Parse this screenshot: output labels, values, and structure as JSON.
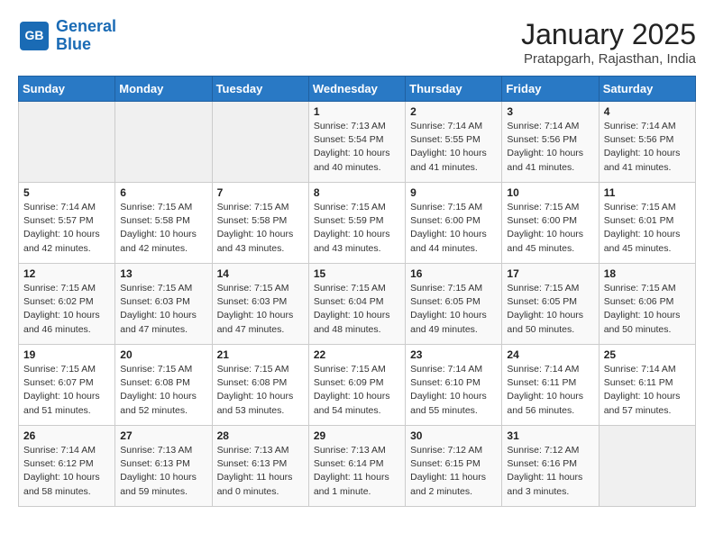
{
  "logo": {
    "line1": "General",
    "line2": "Blue"
  },
  "title": "January 2025",
  "subtitle": "Pratapgarh, Rajasthan, India",
  "weekdays": [
    "Sunday",
    "Monday",
    "Tuesday",
    "Wednesday",
    "Thursday",
    "Friday",
    "Saturday"
  ],
  "weeks": [
    [
      {
        "day": "",
        "info": ""
      },
      {
        "day": "",
        "info": ""
      },
      {
        "day": "",
        "info": ""
      },
      {
        "day": "1",
        "info": "Sunrise: 7:13 AM\nSunset: 5:54 PM\nDaylight: 10 hours\nand 40 minutes."
      },
      {
        "day": "2",
        "info": "Sunrise: 7:14 AM\nSunset: 5:55 PM\nDaylight: 10 hours\nand 41 minutes."
      },
      {
        "day": "3",
        "info": "Sunrise: 7:14 AM\nSunset: 5:56 PM\nDaylight: 10 hours\nand 41 minutes."
      },
      {
        "day": "4",
        "info": "Sunrise: 7:14 AM\nSunset: 5:56 PM\nDaylight: 10 hours\nand 41 minutes."
      }
    ],
    [
      {
        "day": "5",
        "info": "Sunrise: 7:14 AM\nSunset: 5:57 PM\nDaylight: 10 hours\nand 42 minutes."
      },
      {
        "day": "6",
        "info": "Sunrise: 7:15 AM\nSunset: 5:58 PM\nDaylight: 10 hours\nand 42 minutes."
      },
      {
        "day": "7",
        "info": "Sunrise: 7:15 AM\nSunset: 5:58 PM\nDaylight: 10 hours\nand 43 minutes."
      },
      {
        "day": "8",
        "info": "Sunrise: 7:15 AM\nSunset: 5:59 PM\nDaylight: 10 hours\nand 43 minutes."
      },
      {
        "day": "9",
        "info": "Sunrise: 7:15 AM\nSunset: 6:00 PM\nDaylight: 10 hours\nand 44 minutes."
      },
      {
        "day": "10",
        "info": "Sunrise: 7:15 AM\nSunset: 6:00 PM\nDaylight: 10 hours\nand 45 minutes."
      },
      {
        "day": "11",
        "info": "Sunrise: 7:15 AM\nSunset: 6:01 PM\nDaylight: 10 hours\nand 45 minutes."
      }
    ],
    [
      {
        "day": "12",
        "info": "Sunrise: 7:15 AM\nSunset: 6:02 PM\nDaylight: 10 hours\nand 46 minutes."
      },
      {
        "day": "13",
        "info": "Sunrise: 7:15 AM\nSunset: 6:03 PM\nDaylight: 10 hours\nand 47 minutes."
      },
      {
        "day": "14",
        "info": "Sunrise: 7:15 AM\nSunset: 6:03 PM\nDaylight: 10 hours\nand 47 minutes."
      },
      {
        "day": "15",
        "info": "Sunrise: 7:15 AM\nSunset: 6:04 PM\nDaylight: 10 hours\nand 48 minutes."
      },
      {
        "day": "16",
        "info": "Sunrise: 7:15 AM\nSunset: 6:05 PM\nDaylight: 10 hours\nand 49 minutes."
      },
      {
        "day": "17",
        "info": "Sunrise: 7:15 AM\nSunset: 6:05 PM\nDaylight: 10 hours\nand 50 minutes."
      },
      {
        "day": "18",
        "info": "Sunrise: 7:15 AM\nSunset: 6:06 PM\nDaylight: 10 hours\nand 50 minutes."
      }
    ],
    [
      {
        "day": "19",
        "info": "Sunrise: 7:15 AM\nSunset: 6:07 PM\nDaylight: 10 hours\nand 51 minutes."
      },
      {
        "day": "20",
        "info": "Sunrise: 7:15 AM\nSunset: 6:08 PM\nDaylight: 10 hours\nand 52 minutes."
      },
      {
        "day": "21",
        "info": "Sunrise: 7:15 AM\nSunset: 6:08 PM\nDaylight: 10 hours\nand 53 minutes."
      },
      {
        "day": "22",
        "info": "Sunrise: 7:15 AM\nSunset: 6:09 PM\nDaylight: 10 hours\nand 54 minutes."
      },
      {
        "day": "23",
        "info": "Sunrise: 7:14 AM\nSunset: 6:10 PM\nDaylight: 10 hours\nand 55 minutes."
      },
      {
        "day": "24",
        "info": "Sunrise: 7:14 AM\nSunset: 6:11 PM\nDaylight: 10 hours\nand 56 minutes."
      },
      {
        "day": "25",
        "info": "Sunrise: 7:14 AM\nSunset: 6:11 PM\nDaylight: 10 hours\nand 57 minutes."
      }
    ],
    [
      {
        "day": "26",
        "info": "Sunrise: 7:14 AM\nSunset: 6:12 PM\nDaylight: 10 hours\nand 58 minutes."
      },
      {
        "day": "27",
        "info": "Sunrise: 7:13 AM\nSunset: 6:13 PM\nDaylight: 10 hours\nand 59 minutes."
      },
      {
        "day": "28",
        "info": "Sunrise: 7:13 AM\nSunset: 6:13 PM\nDaylight: 11 hours\nand 0 minutes."
      },
      {
        "day": "29",
        "info": "Sunrise: 7:13 AM\nSunset: 6:14 PM\nDaylight: 11 hours\nand 1 minute."
      },
      {
        "day": "30",
        "info": "Sunrise: 7:12 AM\nSunset: 6:15 PM\nDaylight: 11 hours\nand 2 minutes."
      },
      {
        "day": "31",
        "info": "Sunrise: 7:12 AM\nSunset: 6:16 PM\nDaylight: 11 hours\nand 3 minutes."
      },
      {
        "day": "",
        "info": ""
      }
    ]
  ]
}
